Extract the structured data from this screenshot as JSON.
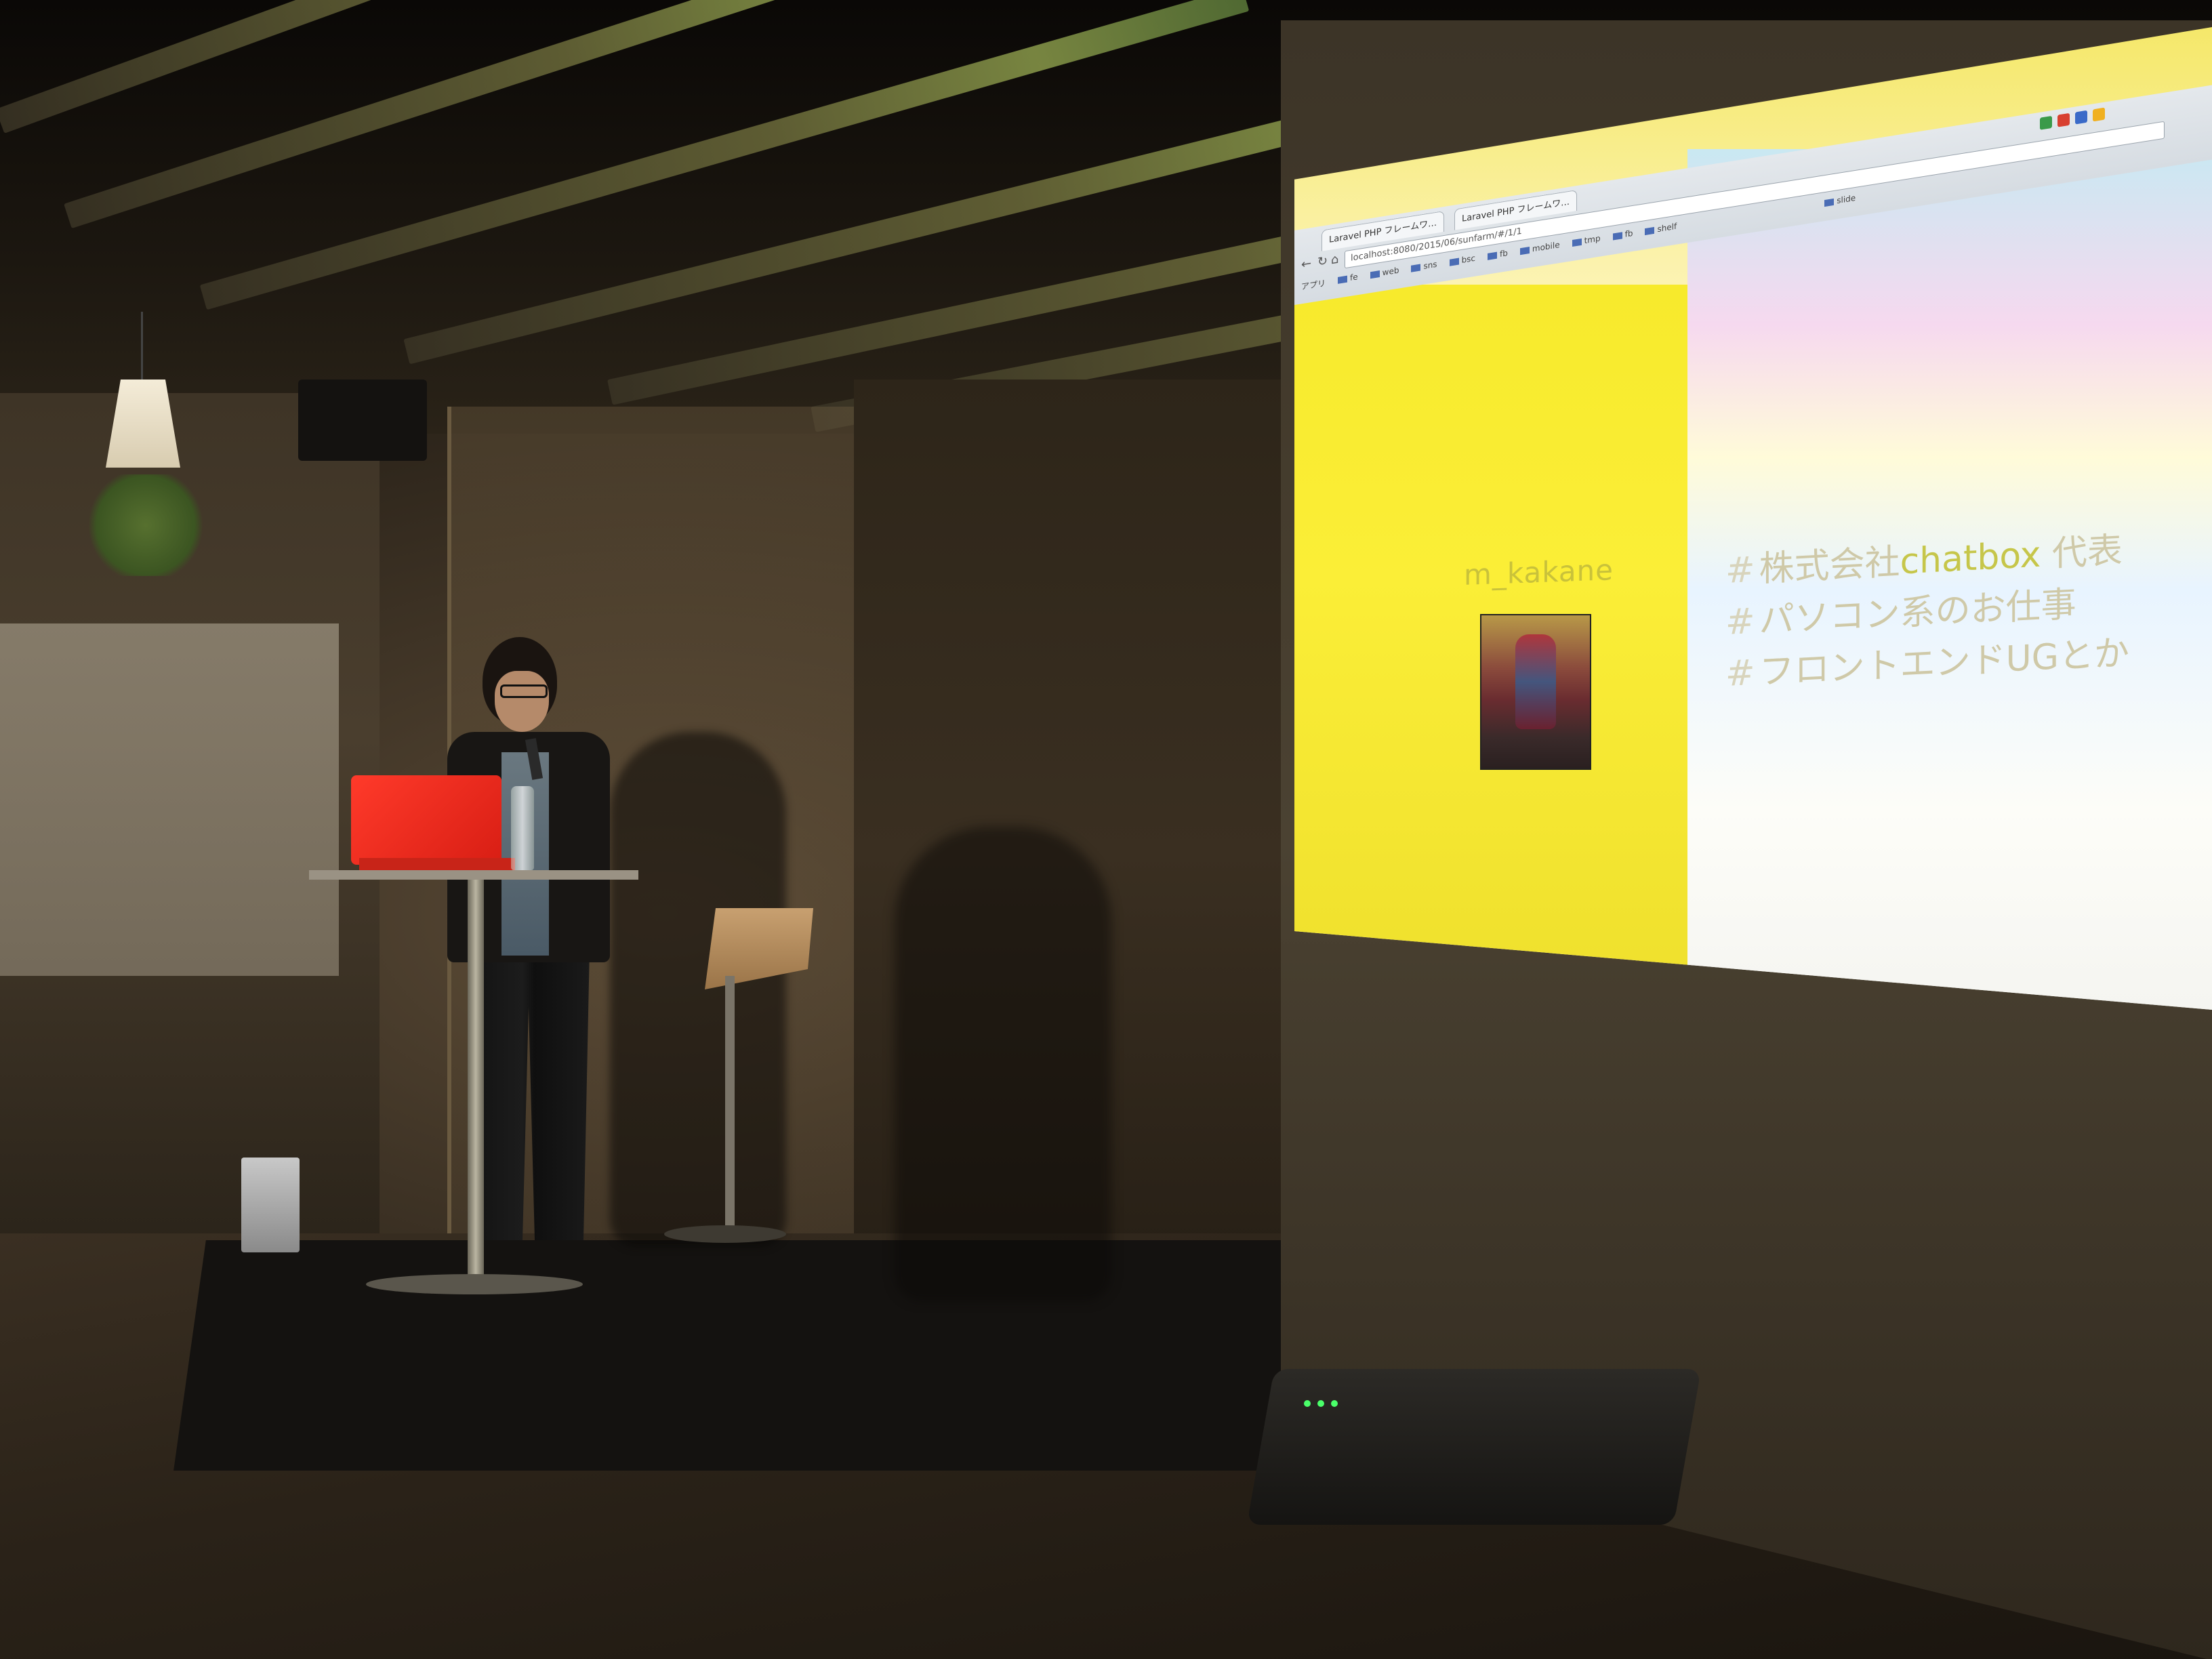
{
  "slide": {
    "presenter_name": "m_kakane",
    "bullets": [
      {
        "hash": "#",
        "prefix": "株式会社",
        "accent": "chatbox",
        "suffix": " 代表"
      },
      {
        "hash": "#",
        "prefix": "パソコン系のお仕事",
        "accent": "",
        "suffix": ""
      },
      {
        "hash": "#",
        "prefix": "フロントエンドUGとか",
        "accent": "",
        "suffix": ""
      }
    ]
  },
  "browser": {
    "tabs": [
      "Laravel PHP フレームワ…",
      "Laravel PHP フレームワ…"
    ],
    "url": "localhost:8080/2015/06/sunfarm/#/1/1",
    "bookmarks": [
      "アプリ",
      "fe",
      "web",
      "sns",
      "bsc",
      "fb",
      "mobile",
      "tmp",
      "fb",
      "shelf"
    ],
    "right_bookmark": "slide"
  },
  "colors": {
    "slide_yellow": "#f7ea2c",
    "laptop_red": "#e8281c",
    "accent_text": "#c6c64a"
  }
}
